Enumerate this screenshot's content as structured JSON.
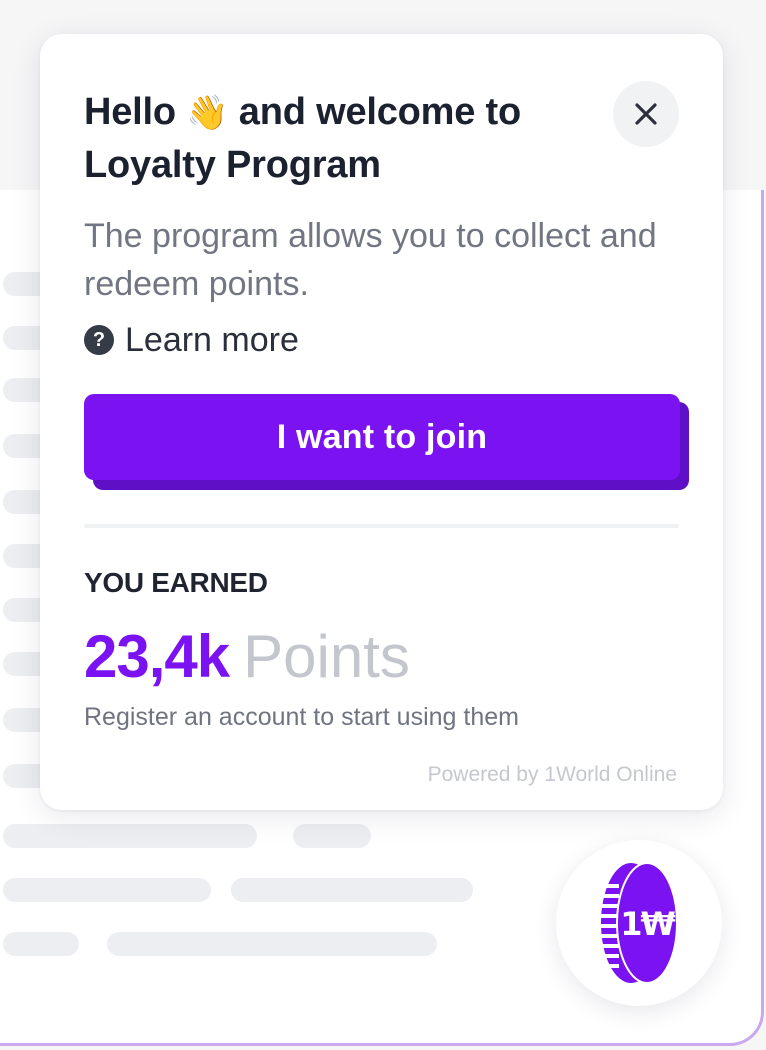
{
  "popup": {
    "title_line1_a": "Hello",
    "title_wave": "👋",
    "title_line1_b": "and welcome to",
    "title_line2": "Loyalty Program",
    "description": "The program allows you to collect and redeem points.",
    "learn_more": "Learn more",
    "learn_more_icon": "?",
    "join_button": "I want to join",
    "earned_label": "YOU EARNED",
    "points_value": "23,4k",
    "points_unit": "Points",
    "register_text": "Register an account to start using them",
    "powered_by": "Powered by 1World Online"
  },
  "launcher": {
    "coin_label": "1₩"
  },
  "colors": {
    "accent": "#7a12f2",
    "accent_dark": "#5f0fc6",
    "text_dark": "#1c2130",
    "text_muted": "#717682",
    "border_lilac": "#c9a8ee"
  }
}
